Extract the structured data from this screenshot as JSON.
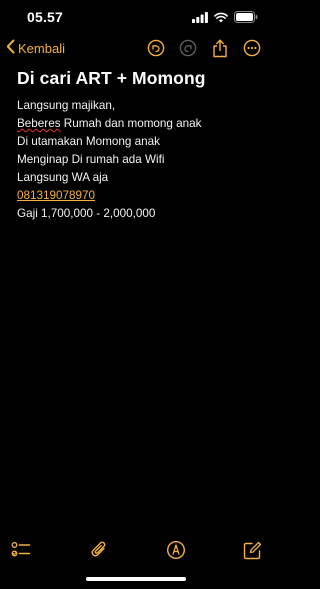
{
  "status_bar": {
    "time": "05.57",
    "icons": [
      "signal-icon",
      "wifi-icon",
      "battery-icon"
    ]
  },
  "nav": {
    "back_label": "Kembali",
    "actions": [
      "undo-icon",
      "redo-icon",
      "share-icon",
      "more-icon"
    ]
  },
  "note": {
    "title": "Di cari ART + Momong",
    "line1": "Langsung majikan,",
    "line2_word": "Beberes",
    "line2_rest": " Rumah dan momong anak",
    "line3": "Di utamakan Momong anak",
    "line4": "Menginap Di rumah ada Wifi",
    "line5": "Langsung WA aja",
    "phone": "081319078970",
    "salary": "Gaji 1,700,000 - 2,000,000"
  },
  "toolbar": {
    "items": [
      "checklist-icon",
      "paperclip-icon",
      "markup-icon",
      "compose-icon"
    ]
  },
  "colors": {
    "background": "#000000",
    "accent": "#f5b041",
    "text": "#ffffff",
    "spellcheck": "#e53935"
  }
}
